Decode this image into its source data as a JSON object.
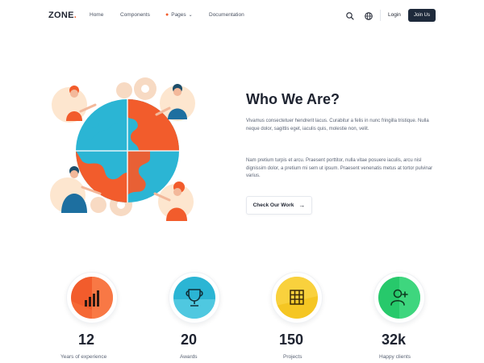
{
  "brand": {
    "name": "ZONE",
    "dot": ".",
    "accent": "#f25c2c",
    "dark": "#1e2a3b"
  },
  "nav": {
    "links": [
      "Home",
      "Components",
      "Pages",
      "Documentation"
    ],
    "pages_caret": "chevron-down-icon",
    "login": "Login",
    "join": "Join Us"
  },
  "about": {
    "title": "Who We Are?",
    "para1": "Vivamus consectetuer hendrerit lacus. Curabitur a felis in nunc fringilla tristique. Nulla neque dolor, sagittis eget, iaculis quis, molestie non, velit.",
    "para2": "Nam pretium turpis et arcu. Praesent porttitor, nulla vitae posuere iaculis, arcu nisl dignissim dolor, a pretium mi sem ut ipsum. Praesent venenatis metus at tortor pulvinar varius.",
    "cta": "Check Our Work",
    "cta_arrow": "→"
  },
  "stats": [
    {
      "value": "12",
      "label": "Years of experience",
      "icon": "chart-icon",
      "color": "#f25c2c"
    },
    {
      "value": "20",
      "label": "Awards",
      "icon": "trophy-icon",
      "color": "#2bb5d4"
    },
    {
      "value": "150",
      "label": "Projects",
      "icon": "grid-icon",
      "color": "#f5c623"
    },
    {
      "value": "32k",
      "label": "Happy clients",
      "icon": "user-plus-icon",
      "color": "#27c96b"
    }
  ]
}
